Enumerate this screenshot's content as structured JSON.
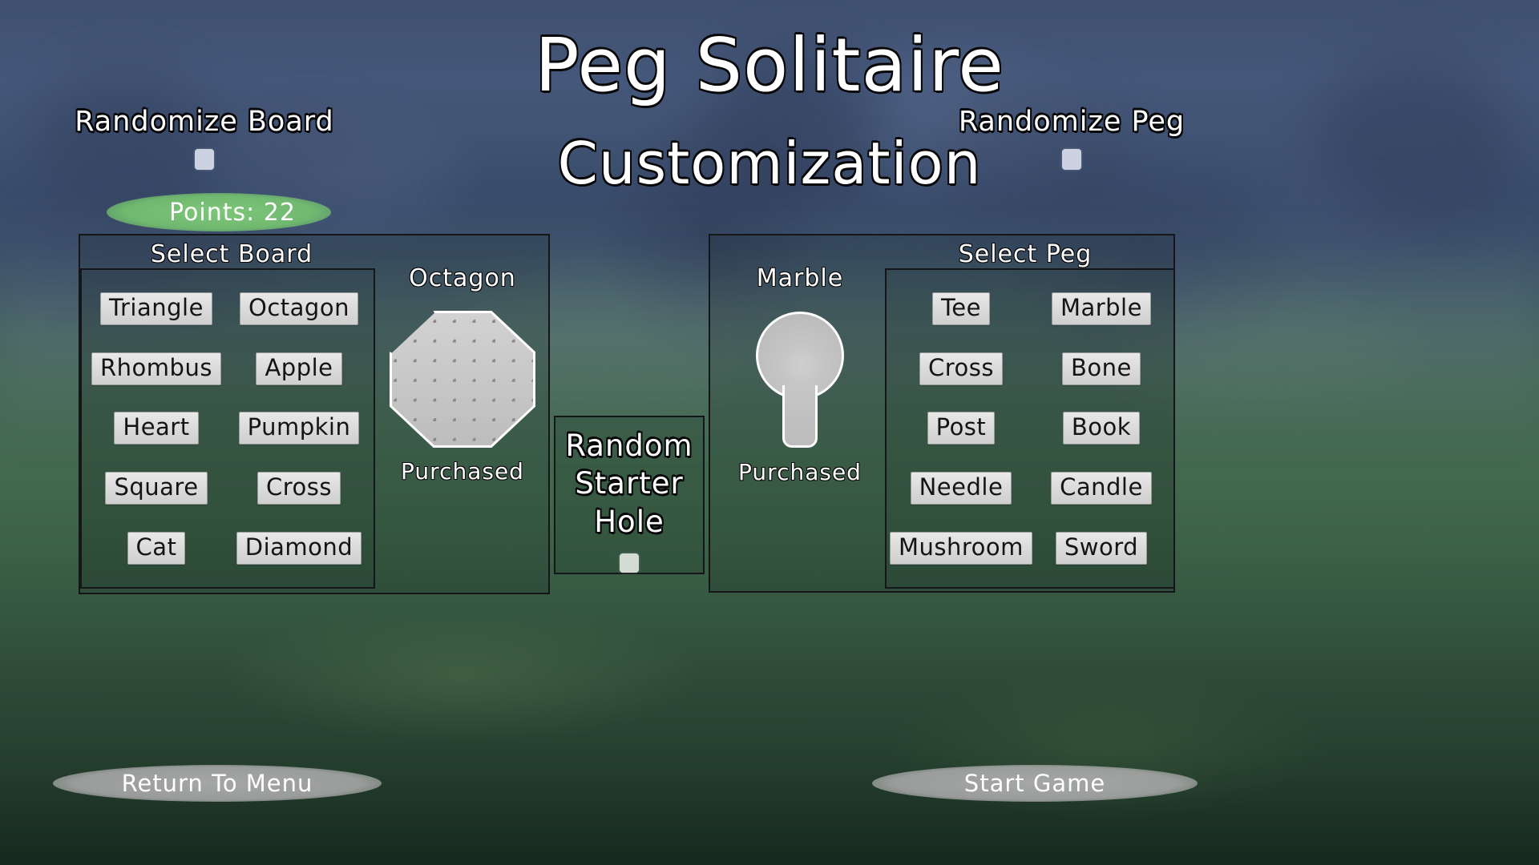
{
  "header": {
    "title_line1": "Peg Solitaire",
    "title_line2": "Customization"
  },
  "toggles": {
    "randomize_board": {
      "label": "Randomize Board",
      "checked": false,
      "checkbox_color": "#cdd2e2"
    },
    "randomize_peg": {
      "label": "Randomize Peg",
      "checked": false,
      "checkbox_color": "#cdd2e2"
    },
    "random_starter_hole": {
      "label_line1": "Random",
      "label_line2": "Starter",
      "label_line3": "Hole",
      "checked": false,
      "checkbox_color": "#d3dcd2"
    }
  },
  "points": {
    "text": "Points: 22",
    "value": 22,
    "pill_color": "#80cd79"
  },
  "board_panel": {
    "title": "Select Board",
    "options": [
      "Triangle",
      "Octagon",
      "Rhombus",
      "Apple",
      "Heart",
      "Pumpkin",
      "Square",
      "Cross",
      "Cat",
      "Diamond"
    ],
    "preview": {
      "name": "Octagon",
      "status": "Purchased",
      "shape": "octagon-board-icon",
      "fill_color": "#c6c6c6",
      "outline_color": "#ffffff",
      "hole_color": "#8a8a8a"
    }
  },
  "peg_panel": {
    "title": "Select Peg",
    "options": [
      "Tee",
      "Marble",
      "Cross",
      "Bone",
      "Post",
      "Book",
      "Needle",
      "Candle",
      "Mushroom",
      "Sword"
    ],
    "preview": {
      "name": "Marble",
      "status": "Purchased",
      "shape": "marble-peg-icon",
      "fill_color": "#c6c6c6",
      "outline_color": "#fdfdfd"
    }
  },
  "footer": {
    "return_label": "Return To Menu",
    "start_label": "Start Game",
    "button_color": "#b0b0b0"
  }
}
